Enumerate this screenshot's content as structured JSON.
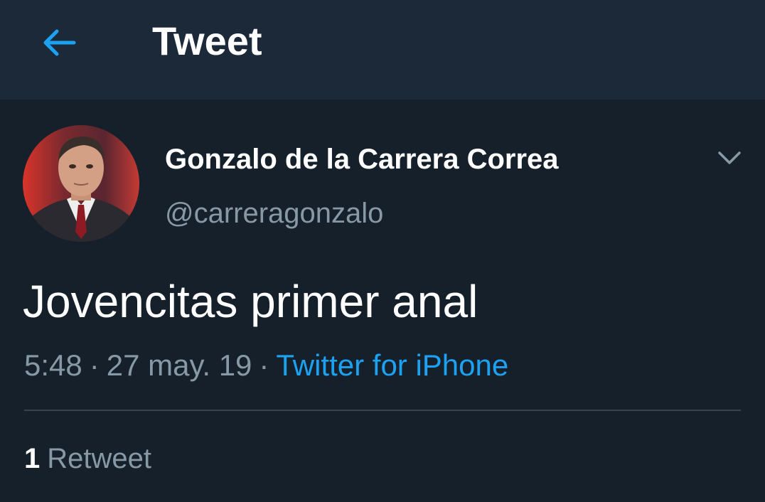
{
  "header": {
    "title": "Tweet",
    "back_icon": "arrow-left-icon",
    "accent_color": "#1da1f2"
  },
  "tweet": {
    "author": {
      "display_name": "Gonzalo de la Carrera Correa",
      "handle": "@carreragonzalo"
    },
    "text": "Jovencitas primer anal",
    "time": "5:48",
    "date": "27 may. 19",
    "separator": "·",
    "source": "Twitter for iPhone",
    "stats": {
      "retweet_count": "1",
      "retweet_label": "Retweet"
    },
    "menu_icon": "chevron-down-icon"
  },
  "colors": {
    "background": "#15202b",
    "header_background": "#1c2938",
    "primary_text": "#ffffff",
    "secondary_text": "#8899a6",
    "link": "#1da1f2",
    "divider": "#38444d"
  }
}
